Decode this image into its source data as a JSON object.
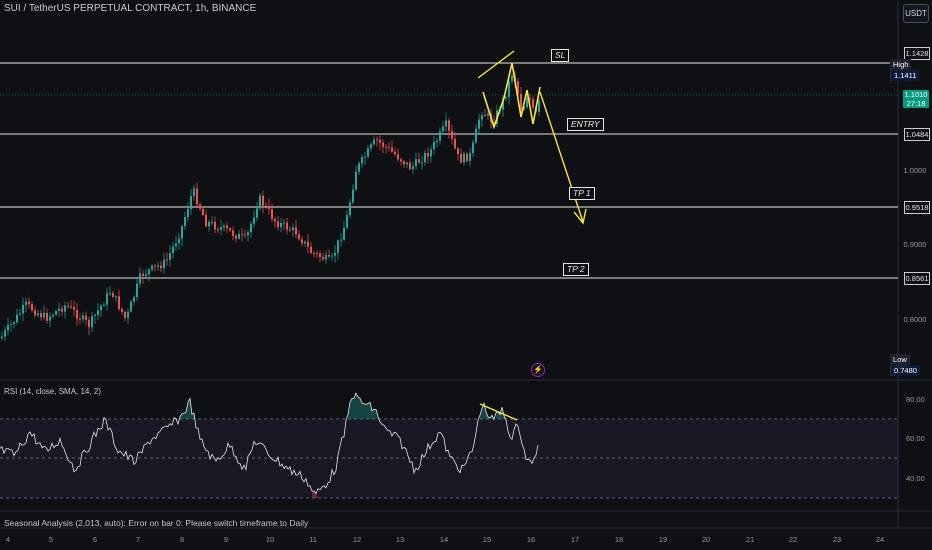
{
  "header": {
    "symbol_title": "SUI / TetherUS PERPETUAL CONTRACT, 1h, BINANCE"
  },
  "currency_button": {
    "label": "USDT"
  },
  "price_axis": {
    "ticks": [
      "1.0000",
      "0.9000",
      "0.8000"
    ],
    "level_labels": [
      "1.1428",
      "1.0484",
      "0.9518",
      "0.8561"
    ],
    "high": {
      "label": "High",
      "value": "1.1411"
    },
    "low": {
      "label": "Low",
      "value": "0.7480"
    },
    "current": {
      "price": "1.1010",
      "countdown": "27:18"
    }
  },
  "annotations": {
    "sl": "SL",
    "entry": "ENTRY",
    "tp1": "TP 1",
    "tp2": "TP 2"
  },
  "rsi": {
    "title": "RSI (14, close, SMA, 14, 2)",
    "axis_ticks": [
      "80.00",
      "60.00",
      "40.00"
    ]
  },
  "seasonal": {
    "message": "Seasonal Analysis (2,013, auto): Error on bar 0: Please switch timeframe to Daily"
  },
  "time_axis": {
    "labels": [
      "4",
      "5",
      "6",
      "7",
      "8",
      "9",
      "10",
      "11",
      "12",
      "13",
      "14",
      "15",
      "16",
      "17",
      "18",
      "19",
      "20",
      "21",
      "22",
      "23",
      "24"
    ]
  },
  "colors": {
    "background": "#0f1014",
    "bull": "#26a69a",
    "bear": "#ef5350",
    "drawing": "#f5e642",
    "level_line": "#e6e6e6",
    "rsi_band": "#7e57c2",
    "current_price": "#089981"
  },
  "icons": {
    "bolt": "lightning-bolt-icon"
  }
}
